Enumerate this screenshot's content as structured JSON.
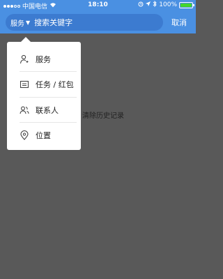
{
  "status_bar": {
    "carrier": "中国电信",
    "time": "18:10",
    "battery": "100%",
    "battery_level": 1.0
  },
  "header": {
    "scope_label": "服务",
    "search_placeholder": "搜索关键字",
    "cancel_label": "取消"
  },
  "background": {
    "history_label": "清除历史记录"
  },
  "dropdown": {
    "items": [
      {
        "label": "服务",
        "icon": "service-icon"
      },
      {
        "label": "任务 / 红包",
        "icon": "task-icon"
      },
      {
        "label": "联系人",
        "icon": "contacts-icon"
      },
      {
        "label": "位置",
        "icon": "location-icon"
      }
    ]
  },
  "colors": {
    "header_bg": "#4a90e2",
    "search_bg": "#3c7bd0",
    "overlay_bg": "#595959",
    "battery": "#44d62c"
  }
}
